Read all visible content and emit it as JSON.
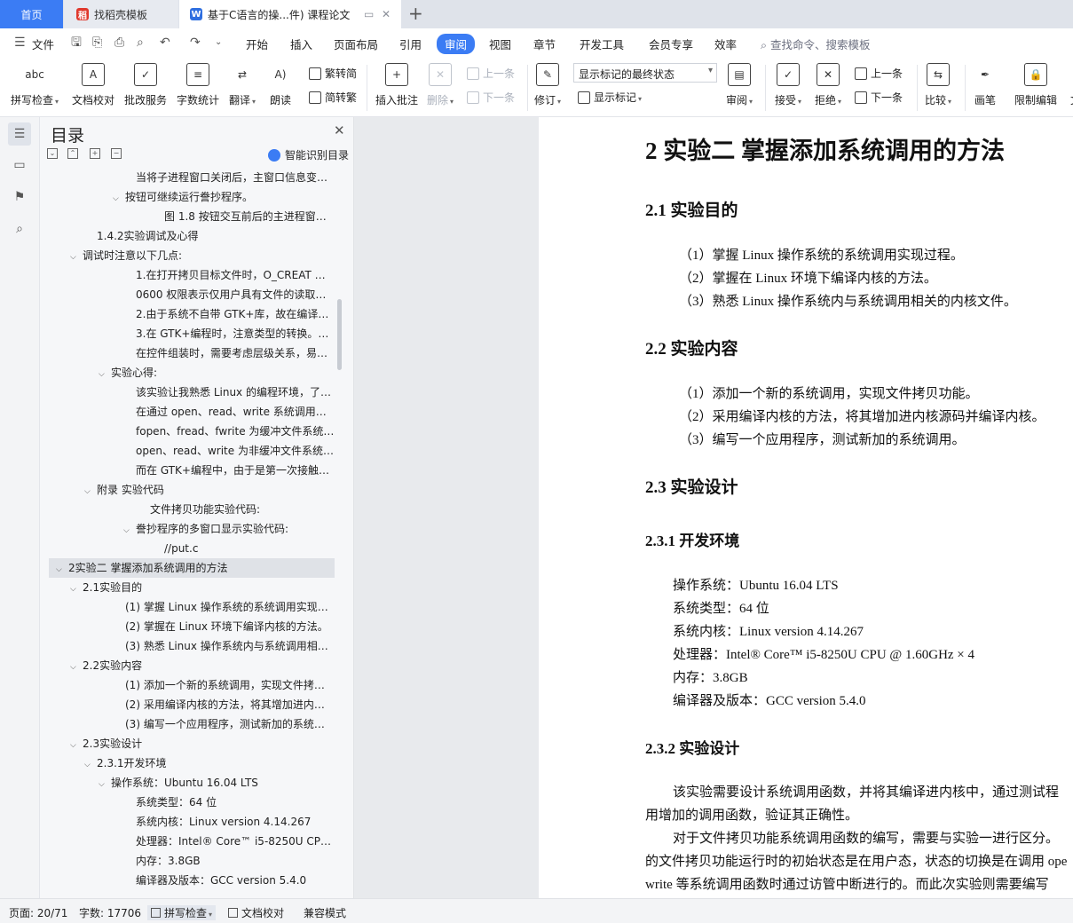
{
  "tabs": {
    "home": "首页",
    "template": "找稻壳模板",
    "document": "基于C语言的操...件) 课程论文"
  },
  "menu": {
    "file": "文件",
    "items": [
      "开始",
      "插入",
      "页面布局",
      "引用",
      "审阅",
      "视图",
      "章节",
      "开发工具",
      "会员专享",
      "效率"
    ],
    "active": "审阅",
    "search": "查找命令、搜索模板"
  },
  "ribbon": {
    "spellcheck": "拼写检查",
    "doc_proof": "文档校对",
    "review_service": "批改服务",
    "word_count": "字数统计",
    "translate": "翻译",
    "read_aloud": "朗读",
    "trad_conv": "繁转简",
    "simp_conv": "简转繁",
    "insert_comment": "插入批注",
    "delete": "删除",
    "prev_comment": "上一条",
    "next_comment": "下一条",
    "track_changes": "修订",
    "markup_state": "显示标记的最终状态",
    "show_markup": "显示标记",
    "review_pane": "审阅",
    "accept": "接受",
    "reject": "拒绝",
    "prev_change": "上一条",
    "next_change": "下一条",
    "compare": "比较",
    "pen": "画笔",
    "restrict": "限制编辑",
    "more": "文"
  },
  "toc": {
    "title": "目录",
    "smart": "智能识别目录",
    "items": [
      {
        "text": "当将子进程窗口关闭后，主窗口信息变换...",
        "level": 5,
        "arrow": ""
      },
      {
        "text": "按钮可继续运行誊抄程序。",
        "level": 4,
        "arrow": "⌵"
      },
      {
        "text": "图 1.8 按钮交互前后的主进程窗口...",
        "level": 7,
        "arrow": ""
      },
      {
        "text": "1.4.2实验调试及心得",
        "level": 2,
        "arrow": ""
      },
      {
        "text": "调试时注意以下几点:",
        "level": 1,
        "arrow": "⌵"
      },
      {
        "text": "1.在打开拷贝目标文件时，O_CREAT 模...",
        "level": 5,
        "arrow": ""
      },
      {
        "text": "0600 权限表示仅用户具有文件的读取和...",
        "level": 5,
        "arrow": ""
      },
      {
        "text": "2.由于系统不自带 GTK+库，故在编译时...",
        "level": 5,
        "arrow": ""
      },
      {
        "text": "3.在 GTK+编程时，注意类型的转换。此...",
        "level": 5,
        "arrow": ""
      },
      {
        "text": "在控件组装时，需要考虑层级关系，易将...",
        "level": 5,
        "arrow": ""
      },
      {
        "text": "实验心得:",
        "level": 3,
        "arrow": "⌵"
      },
      {
        "text": "该实验让我熟悉 Linux 的编程环境，了解...",
        "level": 5,
        "arrow": ""
      },
      {
        "text": "在通过 open、read、write 系统调用的...",
        "level": 5,
        "arrow": ""
      },
      {
        "text": "fopen、fread、fwrite 为缓冲文件系统，...",
        "level": 5,
        "arrow": ""
      },
      {
        "text": "open、read、write 为非缓冲文件系统，...",
        "level": 5,
        "arrow": ""
      },
      {
        "text": "而在 GTK+编程中，由于是第一次接触前...",
        "level": 5,
        "arrow": ""
      },
      {
        "text": "附录 实验代码",
        "level": 2,
        "arrow": "⌵"
      },
      {
        "text": "文件拷贝功能实验代码:",
        "level": 6,
        "arrow": ""
      },
      {
        "text": "誊抄程序的多窗口显示实验代码:",
        "level": 5,
        "arrow": "⌵"
      },
      {
        "text": "//put.c",
        "level": 7,
        "arrow": ""
      },
      {
        "text": "2实验二 掌握添加系统调用的方法",
        "level": 0,
        "arrow": "⌵",
        "selected": true
      },
      {
        "text": "2.1实验目的",
        "level": 1,
        "arrow": "⌵"
      },
      {
        "text": "(1) 掌握 Linux 操作系统的系统调用实现过程...",
        "level": 4,
        "arrow": ""
      },
      {
        "text": "(2) 掌握在 Linux 环境下编译内核的方法。",
        "level": 4,
        "arrow": ""
      },
      {
        "text": "(3) 熟悉 Linux 操作系统内与系统调用相关的...",
        "level": 4,
        "arrow": ""
      },
      {
        "text": "2.2实验内容",
        "level": 1,
        "arrow": "⌵"
      },
      {
        "text": "(1) 添加一个新的系统调用，实现文件拷贝功...",
        "level": 4,
        "arrow": ""
      },
      {
        "text": "(2) 采用编译内核的方法，将其增加进内核源...",
        "level": 4,
        "arrow": ""
      },
      {
        "text": "(3) 编写一个应用程序，测试新加的系统调用...",
        "level": 4,
        "arrow": ""
      },
      {
        "text": "2.3实验设计",
        "level": 1,
        "arrow": "⌵"
      },
      {
        "text": "2.3.1开发环境",
        "level": 2,
        "arrow": "⌵"
      },
      {
        "text": "操作系统：Ubuntu 16.04 LTS",
        "level": 3,
        "arrow": "⌵"
      },
      {
        "text": "系统类型：64 位",
        "level": 5,
        "arrow": ""
      },
      {
        "text": "系统内核：Linux version 4.14.267",
        "level": 5,
        "arrow": ""
      },
      {
        "text": "处理器：Intel® Core™ i5-8250U CPU @...",
        "level": 5,
        "arrow": ""
      },
      {
        "text": "内存：3.8GB",
        "level": 5,
        "arrow": ""
      },
      {
        "text": "编译器及版本：GCC version 5.4.0",
        "level": 5,
        "arrow": ""
      }
    ]
  },
  "doc": {
    "h1": "2  实验二  掌握添加系统调用的方法",
    "s21": "2.1  实验目的",
    "s21_items": [
      "（1）掌握  Linux 操作系统的系统调用实现过程。",
      "（2）掌握在  Linux 环境下编译内核的方法。",
      "（3）熟悉  Linux 操作系统内与系统调用相关的内核文件。"
    ],
    "s22": "2.2  实验内容",
    "s22_items": [
      "（1）添加一个新的系统调用，实现文件拷贝功能。",
      "（2）采用编译内核的方法，将其增加进内核源码并编译内核。",
      "（3）编写一个应用程序，测试新加的系统调用。"
    ],
    "s23": "2.3  实验设计",
    "s231": "2.3.1    开发环境",
    "env": [
      "操作系统：Ubuntu 16.04 LTS",
      "系统类型：64 位",
      "系统内核：Linux version 4.14.267",
      "处理器：Intel® Core™  i5-8250U CPU @ 1.60GHz ×  4",
      "内存：3.8GB",
      "编译器及版本：GCC version 5.4.0"
    ],
    "s232": "2.3.2    实验设计",
    "para": [
      "该实验需要设计系统调用函数，并将其编译进内核中，通过测试程",
      "用增加的调用函数，验证其正确性。",
      "对于文件拷贝功能系统调用函数的编写，需要与实验一进行区分。",
      "的文件拷贝功能运行时的初始状态是在用户态，状态的切换是在调用  ope",
      "write 等系统调用函数时通过访管中断进行的。而此次实验则需要编写"
    ]
  },
  "status": {
    "page": "页面: 20/71",
    "words": "字数: 17706",
    "spell": "拼写检查",
    "proof": "文档校对",
    "compat": "兼容模式"
  }
}
